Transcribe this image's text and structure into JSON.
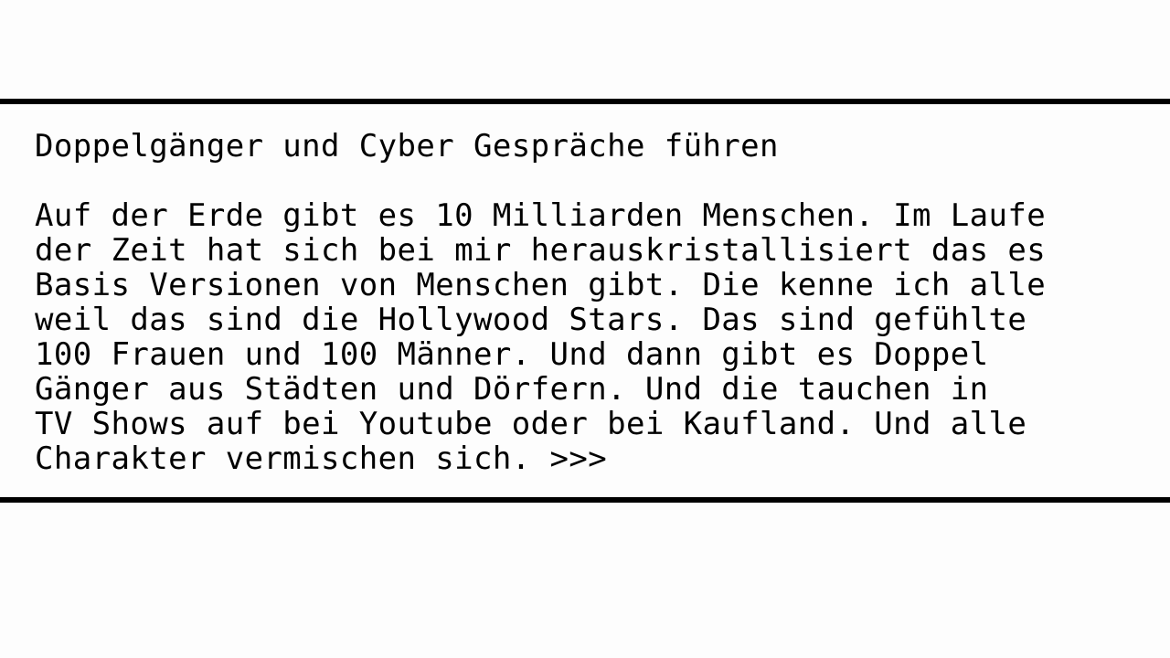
{
  "slide": {
    "title": "Doppelgänger und Cyber Gespräche führen",
    "lines": [
      "Auf der Erde gibt es 10 Milliarden Menschen. Im Laufe",
      "der Zeit hat sich bei mir herauskristallisiert das es",
      "Basis Versionen von Menschen gibt. Die kenne ich alle",
      "weil das sind die Hollywood Stars. Das sind gefühlte",
      "100 Frauen und 100 Männer. Und dann gibt es Doppel",
      "Gänger aus Städten und Dörfern. Und die tauchen in",
      "TV Shows auf bei Youtube oder bei Kaufland. Und alle",
      "Charakter vermischen sich. >>>"
    ]
  }
}
